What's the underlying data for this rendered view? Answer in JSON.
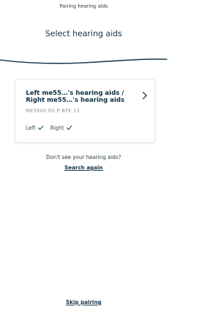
{
  "header": {
    "top_title": "Pairing hearing aids",
    "page_title": "Select hearing aids"
  },
  "device_card": {
    "name": "Left me55…'s hearing aids / Right me55…'s hearing aids",
    "model": "ME5500 DS P BTE 13",
    "left_label": "Left",
    "right_label": "Right",
    "left_status": "checked",
    "right_status": "checked"
  },
  "help": {
    "prompt": "Don't see your hearing aids?",
    "search_again": "Search again"
  },
  "footer": {
    "skip_pairing": "Skip pairing"
  },
  "colors": {
    "wave_line": "#16394d",
    "check": "#1c5a78",
    "text_dark": "#0d2d40"
  },
  "icons": [
    "chevron-right-icon",
    "checkmark-icon"
  ]
}
